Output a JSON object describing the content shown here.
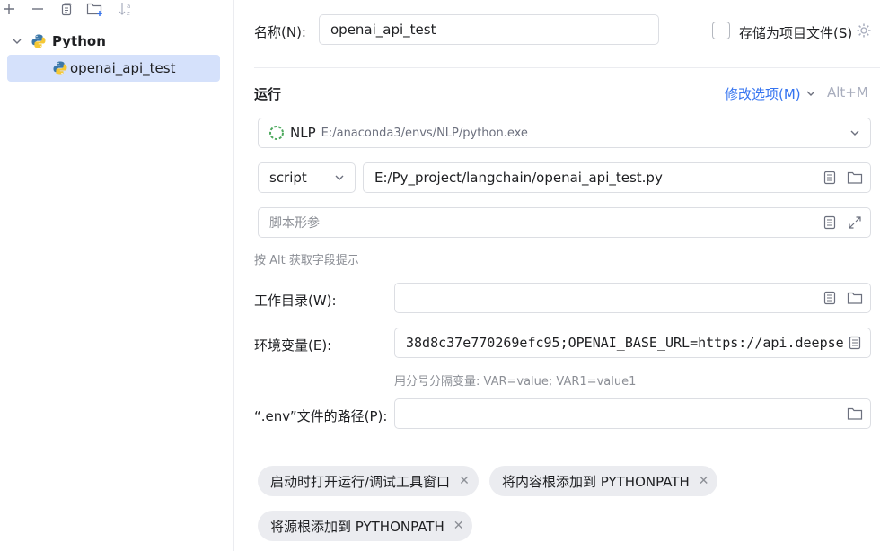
{
  "tree": {
    "root_label": "Python",
    "child_label": "openai_api_test"
  },
  "form": {
    "name_label": "名称(N):",
    "name_value": "openai_api_test",
    "store_label": "存储为项目文件(S)",
    "run_section": "运行",
    "modify_options": "修改选项(M)",
    "modify_shortcut": "Alt+M",
    "interpreter_name": "NLP",
    "interpreter_path": "E:/anaconda3/envs/NLP/python.exe",
    "script_type": "script",
    "script_path": "E:/Py_project/langchain/openai_api_test.py",
    "script_params_placeholder": "脚本形参",
    "alt_hint": "按 Alt 获取字段提示",
    "workdir_label": "工作目录(W):",
    "workdir_value": "",
    "env_label": "环境变量(E):",
    "env_value": "38d8c37e770269efc95;OPENAI_BASE_URL=https://api.deepse",
    "env_hint": "用分号分隔变量: VAR=value; VAR1=value1",
    "dotenv_label": "“.env”文件的路径(P):",
    "dotenv_value": ""
  },
  "chips": [
    {
      "label": "启动时打开运行/调试工具窗口"
    },
    {
      "label": "将内容根添加到 PYTHONPATH"
    },
    {
      "label": "将源根添加到 PYTHONPATH"
    }
  ],
  "colors": {
    "selection": "#d5e1fb",
    "link": "#3574f0",
    "chip_bg": "#ebecf0",
    "border": "#dcdee3"
  }
}
